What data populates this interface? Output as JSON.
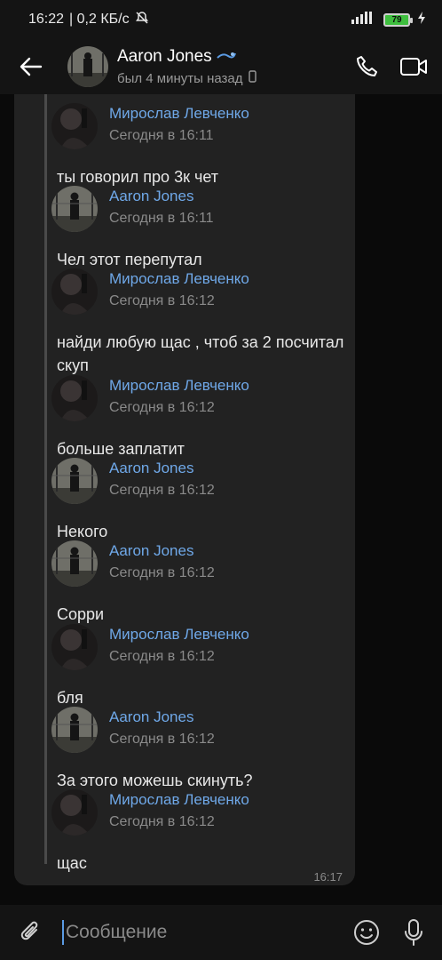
{
  "statusbar": {
    "time": "16:22",
    "speed": "| 0,2 КБ/с",
    "battery": "79"
  },
  "header": {
    "name": "Aaron Jones",
    "status": "был 4 минуты назад"
  },
  "messages": [
    {
      "author": "Мирослав Левченко",
      "time": "Сегодня в 16:11",
      "text": "ты говорил про 3к чет",
      "avatar": "dark"
    },
    {
      "author": "Aaron Jones",
      "time": "Сегодня в 16:11",
      "text": "Чел этот перепутал",
      "avatar": "street"
    },
    {
      "author": "Мирослав Левченко",
      "time": "Сегодня в 16:12",
      "text": "найди любую щас , чтоб за 2 посчитал скуп",
      "avatar": "dark"
    },
    {
      "author": "Мирослав Левченко",
      "time": "Сегодня в 16:12",
      "text": "больше заплатит",
      "avatar": "dark"
    },
    {
      "author": "Aaron Jones",
      "time": "Сегодня в 16:12",
      "text": "Некого",
      "avatar": "street"
    },
    {
      "author": "Aaron Jones",
      "time": "Сегодня в 16:12",
      "text": "Сорри",
      "avatar": "street"
    },
    {
      "author": "Мирослав Левченко",
      "time": "Сегодня в 16:12",
      "text": "бля",
      "avatar": "dark"
    },
    {
      "author": "Aaron Jones",
      "time": "Сегодня в 16:12",
      "text": "За этого можешь скинуть?",
      "avatar": "street"
    },
    {
      "author": "Мирослав Левченко",
      "time": "Сегодня в 16:12",
      "text": "щас",
      "avatar": "dark"
    }
  ],
  "bubble_time": "16:17",
  "composer": {
    "placeholder": "Сообщение"
  },
  "colors": {
    "author": "#6fa8e8",
    "background": "#0a0a0a",
    "bubble": "#222222",
    "accent": "#5b9be3"
  }
}
